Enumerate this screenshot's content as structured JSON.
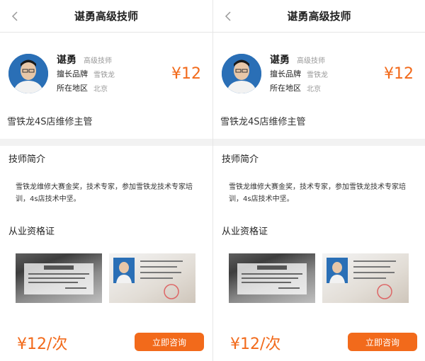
{
  "screens": [
    {
      "nav": {
        "title": "谌勇高级技师"
      },
      "profile": {
        "name": "谌勇",
        "title": "高级技师",
        "brand_key": "擅长品牌",
        "brand_val": "雪铁龙",
        "region_key": "所在地区",
        "region_val": "北京",
        "price": "¥12"
      },
      "headline": "雪铁龙4S店维修主管",
      "intro": {
        "title": "技师简介",
        "text": "雪铁龙维修大赛金奖，技术专家，参加雪铁龙技术专家培训，4s店技术中坚。"
      },
      "certs": {
        "title": "从业资格证"
      },
      "bottom": {
        "price": "¥12/次",
        "consult": "立即咨询"
      }
    },
    {
      "nav": {
        "title": "谌勇高级技师"
      },
      "profile": {
        "name": "谌勇",
        "title": "高级技师",
        "brand_key": "擅长品牌",
        "brand_val": "雪铁龙",
        "region_key": "所在地区",
        "region_val": "北京",
        "price": "¥12"
      },
      "headline": "雪铁龙4S店维修主管",
      "intro": {
        "title": "技师简介",
        "text": "雪铁龙维修大赛金奖，技术专家，参加雪铁龙技术专家培训，4s店技术中坚。"
      },
      "certs": {
        "title": "从业资格证"
      },
      "bottom": {
        "price": "¥12/次",
        "consult": "立即咨询"
      }
    }
  ],
  "colors": {
    "accent": "#f26a1b",
    "divider": "#f2f2f2"
  },
  "icons": {
    "back": "chevron-left-icon"
  }
}
